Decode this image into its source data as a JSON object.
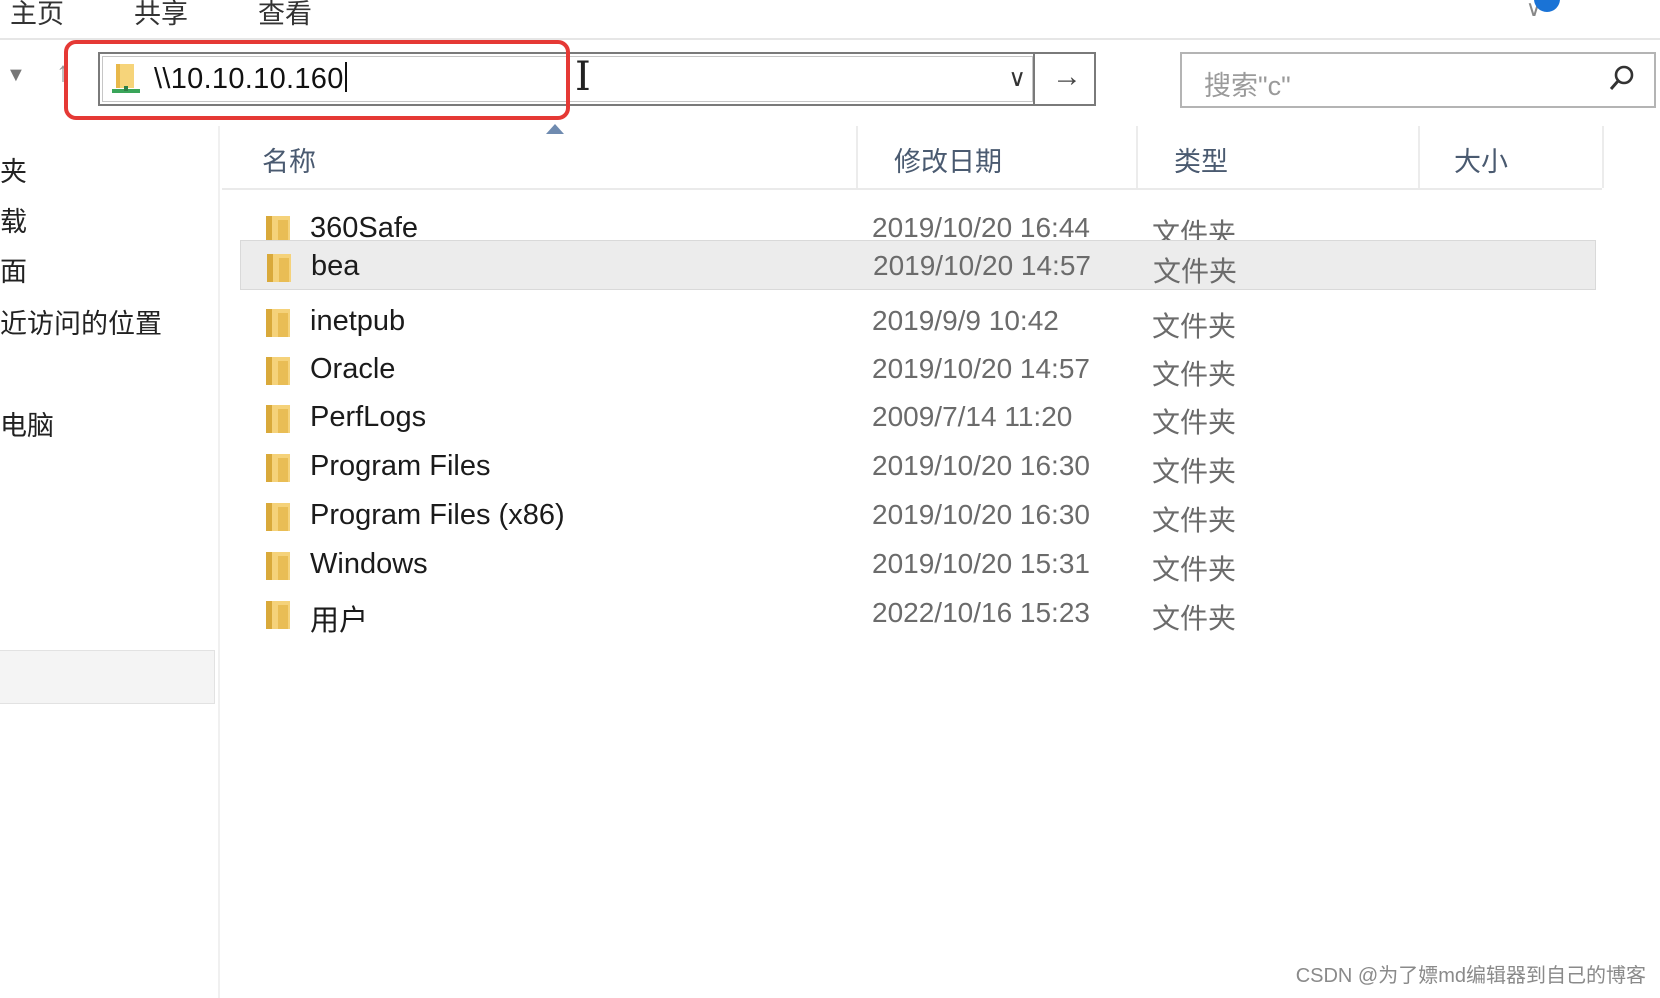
{
  "ribbon": {
    "tabs": [
      "主页",
      "共享",
      "查看"
    ]
  },
  "nav": {
    "back_icon": "chevron-down-icon",
    "up_icon": "up-arrow-icon"
  },
  "address_bar": {
    "value": "\\\\10.10.10.160",
    "dropdown_icon": "chevron-down-icon",
    "go_icon": "right-arrow-icon"
  },
  "search": {
    "placeholder": "搜索\"c\""
  },
  "sidebar": {
    "items": [
      "夹",
      "载",
      "面",
      "近访问的位置",
      "电脑"
    ]
  },
  "columns": [
    "名称",
    "修改日期",
    "类型",
    "大小"
  ],
  "files": [
    {
      "name": "360Safe",
      "date": "2019/10/20 16:44",
      "type": "文件夹"
    },
    {
      "name": "bea",
      "date": "2019/10/20 14:57",
      "type": "文件夹"
    },
    {
      "name": "inetpub",
      "date": "2019/9/9 10:42",
      "type": "文件夹"
    },
    {
      "name": "Oracle",
      "date": "2019/10/20 14:57",
      "type": "文件夹"
    },
    {
      "name": "PerfLogs",
      "date": "2009/7/14 11:20",
      "type": "文件夹"
    },
    {
      "name": "Program Files",
      "date": "2019/10/20 16:30",
      "type": "文件夹"
    },
    {
      "name": "Program Files (x86)",
      "date": "2019/10/20 16:30",
      "type": "文件夹"
    },
    {
      "name": "Windows",
      "date": "2019/10/20 15:31",
      "type": "文件夹"
    },
    {
      "name": "用户",
      "date": "2022/10/16 15:23",
      "type": "文件夹"
    }
  ],
  "selected_file": "bea",
  "colors": {
    "highlight": "#e53935",
    "folder": "#f2c94c",
    "header_text": "#4a5a70"
  },
  "watermark": "CSDN @为了嫖md编辑器到自己的博客"
}
